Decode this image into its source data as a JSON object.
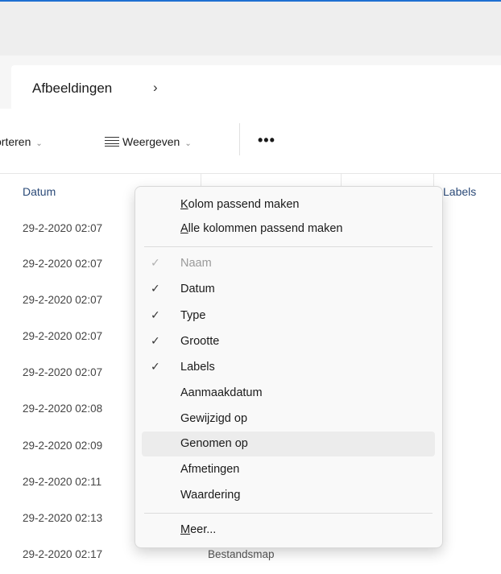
{
  "address": {
    "crumb": "Afbeeldingen",
    "separator": "›"
  },
  "toolbar": {
    "sort_label": "orteren",
    "view_label": "Weergeven",
    "more_label": "•••"
  },
  "columns": {
    "date": "Datum",
    "labels": "Labels"
  },
  "rows": [
    "29-2-2020 02:07",
    "29-2-2020 02:07",
    "29-2-2020 02:07",
    "29-2-2020 02:07",
    "29-2-2020 02:07",
    "29-2-2020 02:08",
    "29-2-2020 02:09",
    "29-2-2020 02:11",
    "29-2-2020 02:13",
    "29-2-2020 02:17"
  ],
  "last_row_type": "Bestandsmap",
  "menu": {
    "fit_column": {
      "first": "K",
      "rest": "olom passend maken"
    },
    "fit_all": {
      "first": "A",
      "rest": "lle kolommen passend maken"
    },
    "items": [
      {
        "label": "Naam",
        "checked": true,
        "disabled": true
      },
      {
        "label": "Datum",
        "checked": true
      },
      {
        "label": "Type",
        "checked": true
      },
      {
        "label": "Grootte",
        "checked": true
      },
      {
        "label": "Labels",
        "checked": true
      },
      {
        "label": "Aanmaakdatum",
        "checked": false
      },
      {
        "label": "Gewijzigd op",
        "checked": false
      },
      {
        "label": "Genomen op",
        "checked": false,
        "highlighted": true
      },
      {
        "label": "Afmetingen",
        "checked": false
      },
      {
        "label": "Waardering",
        "checked": false
      }
    ],
    "more": {
      "first": "M",
      "rest": "eer..."
    },
    "check_glyph": "✓"
  }
}
